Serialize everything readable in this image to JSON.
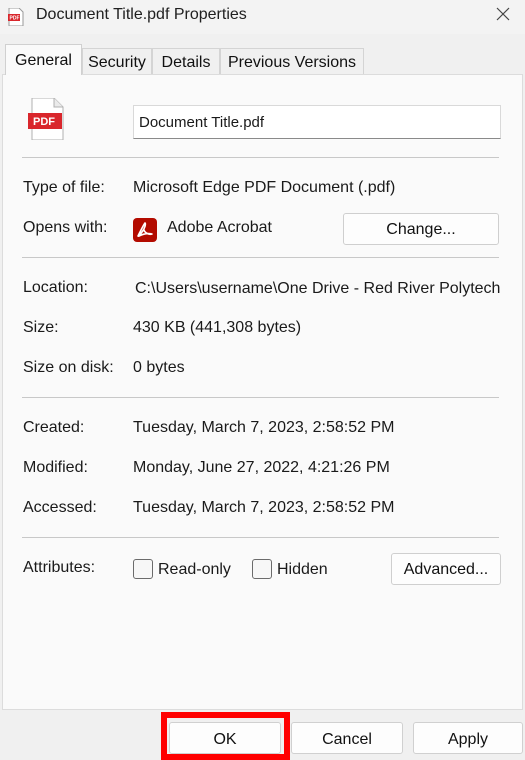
{
  "window": {
    "title": "Document Title.pdf Properties",
    "title_icon": "pdf-file-icon",
    "close_icon": "close-icon"
  },
  "tabs": [
    {
      "label": "General",
      "active": true
    },
    {
      "label": "Security",
      "active": false
    },
    {
      "label": "Details",
      "active": false
    },
    {
      "label": "Previous Versions",
      "active": false
    }
  ],
  "general": {
    "file_icon_text": "PDF",
    "filename": "Document Title.pdf",
    "type_label": "Type of file:",
    "type_value": "Microsoft Edge PDF Document (.pdf)",
    "opens_label": "Opens with:",
    "opens_app": "Adobe Acrobat",
    "change_button": "Change...",
    "location_label": "Location:",
    "location_value": "C:\\Users\\username\\One Drive - Red River Polytech",
    "size_label": "Size:",
    "size_value": "430 KB (441,308 bytes)",
    "size_on_disk_label": "Size on disk:",
    "size_on_disk_value": "0 bytes",
    "created_label": "Created:",
    "created_value": "Tuesday, March 7, 2023, 2:58:52 PM",
    "modified_label": "Modified:",
    "modified_value": "Monday, June 27, 2022, 4:21:26 PM",
    "accessed_label": "Accessed:",
    "accessed_value": "Tuesday, March 7, 2023, 2:58:52 PM",
    "attributes_label": "Attributes:",
    "readonly_label": "Read-only",
    "readonly_checked": false,
    "hidden_label": "Hidden",
    "hidden_checked": false,
    "advanced_button": "Advanced..."
  },
  "footer": {
    "ok_label": "OK",
    "cancel_label": "Cancel",
    "apply_label": "Apply"
  },
  "colors": {
    "pdf_red": "#d9262c",
    "acrobat_red": "#b30b00",
    "highlight": "#ff0000"
  }
}
